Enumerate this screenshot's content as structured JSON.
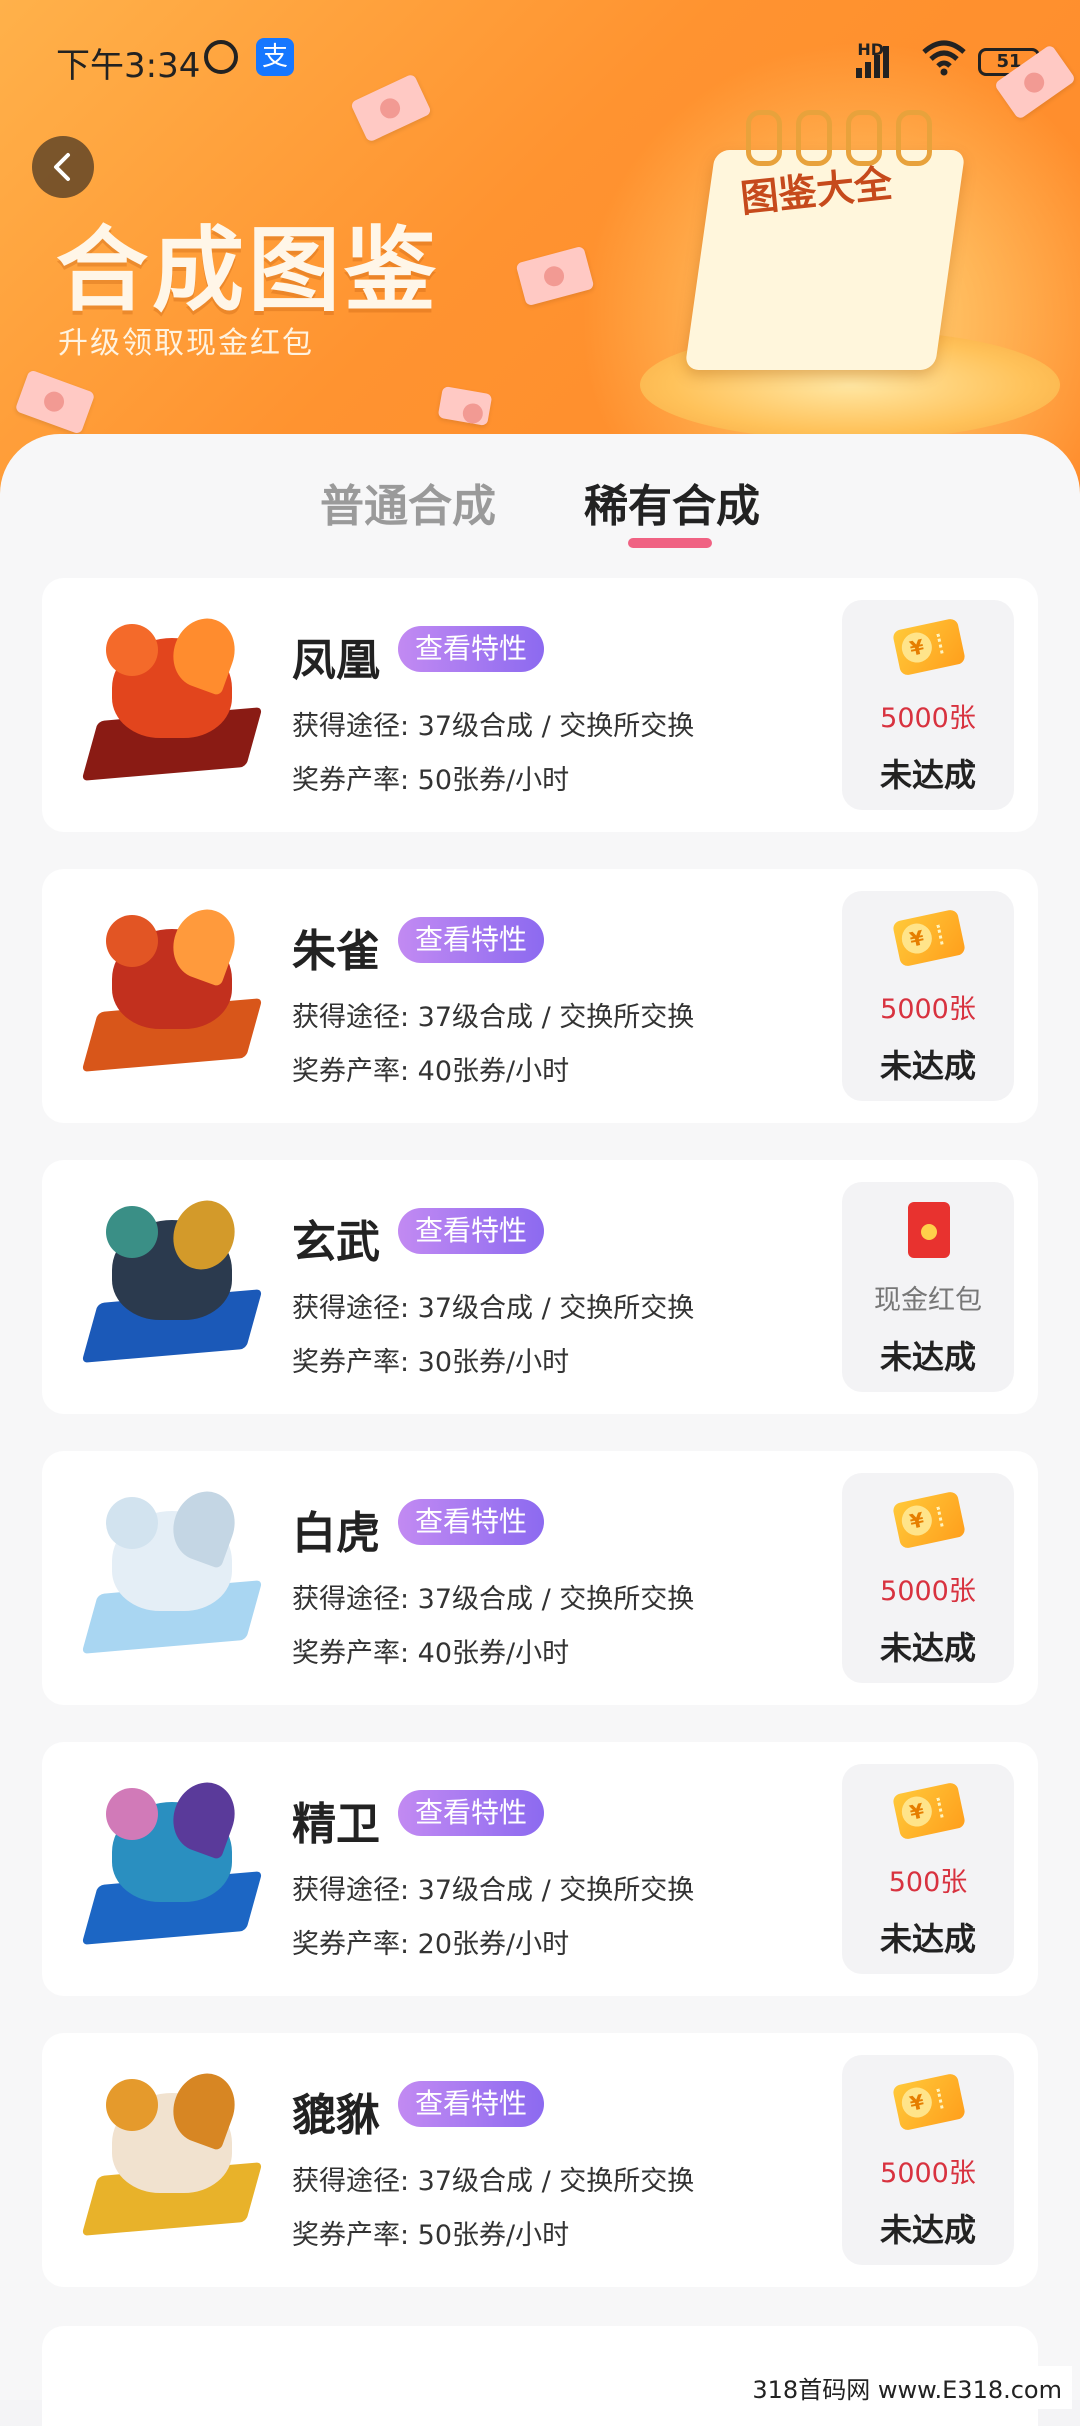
{
  "status_bar": {
    "time": "下午3:34",
    "network": "HD",
    "battery": "51"
  },
  "header": {
    "title": "合成图鉴",
    "subtitle": "升级领取现金红包",
    "illustration_label": "图鉴大全"
  },
  "tabs": [
    {
      "label": "普通合成",
      "active": false
    },
    {
      "label": "稀有合成",
      "active": true
    }
  ],
  "colors": {
    "accent": "#f06283",
    "header_orange": "#ff9330",
    "button_purple": "#a47aef",
    "amount_red": "#d8323f"
  },
  "cards": [
    {
      "name": "凤凰",
      "feature_label": "查看特性",
      "route": "获得途径: 37级合成 / 交换所交换",
      "rate": "奖券产率: 50张券/小时",
      "reward_icon": "coupon-icon",
      "reward_amount": "5000张",
      "status": "未达成"
    },
    {
      "name": "朱雀",
      "feature_label": "查看特性",
      "route": "获得途径: 37级合成 / 交换所交换",
      "rate": "奖券产率: 40张券/小时",
      "reward_icon": "coupon-icon",
      "reward_amount": "5000张",
      "status": "未达成"
    },
    {
      "name": "玄武",
      "feature_label": "查看特性",
      "route": "获得途径: 37级合成 / 交换所交换",
      "rate": "奖券产率: 30张券/小时",
      "reward_icon": "red-packet-icon",
      "reward_amount": "现金红包",
      "status": "未达成"
    },
    {
      "name": "白虎",
      "feature_label": "查看特性",
      "route": "获得途径: 37级合成 / 交换所交换",
      "rate": "奖券产率: 40张券/小时",
      "reward_icon": "coupon-icon",
      "reward_amount": "5000张",
      "status": "未达成"
    },
    {
      "name": "精卫",
      "feature_label": "查看特性",
      "route": "获得途径: 37级合成 / 交换所交换",
      "rate": "奖券产率: 20张券/小时",
      "reward_icon": "coupon-icon",
      "reward_amount": "500张",
      "status": "未达成"
    },
    {
      "name": "貔貅",
      "feature_label": "查看特性",
      "route": "获得途径: 37级合成 / 交换所交换",
      "rate": "奖券产率: 50张券/小时",
      "reward_icon": "coupon-icon",
      "reward_amount": "5000张",
      "status": "未达成"
    }
  ],
  "watermark": "318首码网 www.E318.com"
}
